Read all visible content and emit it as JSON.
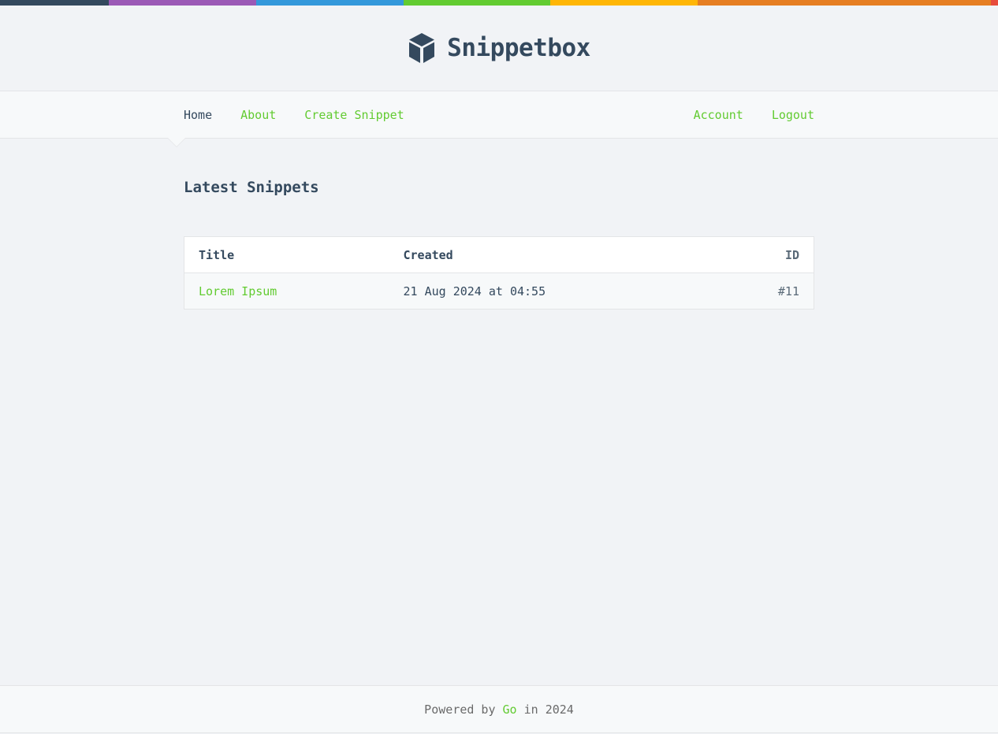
{
  "topbar_colors": [
    "#34495e",
    "#9b59b6",
    "#3498db",
    "#62cb31",
    "#ffb606",
    "#e67e22",
    "#e74c3c"
  ],
  "brand": {
    "icon": "cube-icon",
    "title": "Snippetbox"
  },
  "nav": {
    "left": [
      {
        "label": "Home",
        "active": true
      },
      {
        "label": "About"
      },
      {
        "label": "Create Snippet"
      }
    ],
    "right": [
      {
        "label": "Account"
      },
      {
        "label": "Logout"
      }
    ]
  },
  "main": {
    "heading": "Latest Snippets",
    "table": {
      "headers": [
        "Title",
        "Created",
        "ID"
      ],
      "rows": [
        {
          "title": "Lorem Ipsum",
          "created": "21 Aug 2024 at 04:55",
          "id": "#11"
        }
      ]
    }
  },
  "footer": {
    "prefix": "Powered by",
    "link": "Go",
    "suffix": "in 2024"
  },
  "colors": {
    "accent": "#62cb31",
    "text": "#34495e",
    "background": "#f1f3f6"
  }
}
